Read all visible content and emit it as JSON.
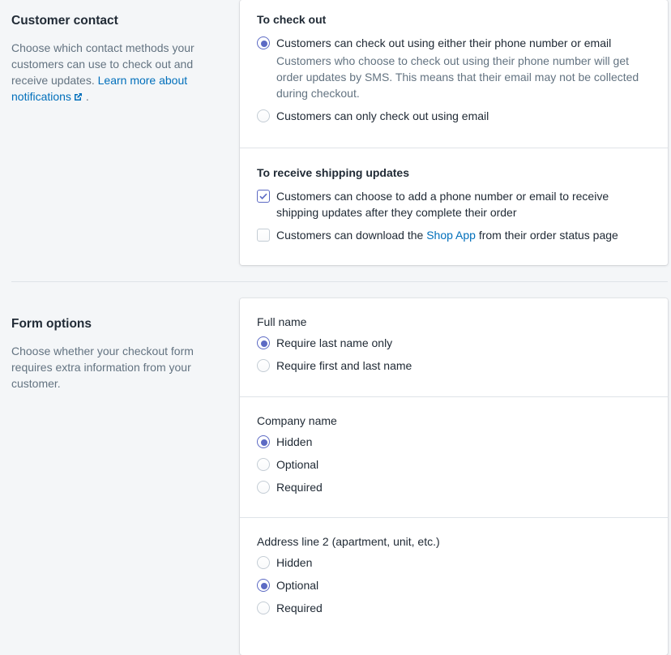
{
  "customer_contact": {
    "title": "Customer contact",
    "description": "Choose which contact methods your customers can use to check out and receive updates.",
    "learn_more_link": "Learn more about notifications",
    "trailing_period": ".",
    "external_icon": "external-link-icon",
    "checkout": {
      "heading": "To check out",
      "options": [
        {
          "label": "Customers can check out using either their phone number or email",
          "help": "Customers who choose to check out using their phone number will get order updates by SMS. This means that their email may not be collected during checkout.",
          "selected": true
        },
        {
          "label": "Customers can only check out using email",
          "selected": false
        }
      ]
    },
    "shipping_updates": {
      "heading": "To receive shipping updates",
      "option_1_label": "Customers can choose to add a phone number or email to receive shipping updates after they complete their order",
      "option_1_checked": true,
      "option_2_prefix": "Customers can download the",
      "option_2_link": "Shop App",
      "option_2_suffix": "from their order status page",
      "option_2_checked": false
    }
  },
  "form_options": {
    "title": "Form options",
    "description": "Choose whether your checkout form requires extra information from your customer.",
    "full_name": {
      "heading": "Full name",
      "options": [
        {
          "label": "Require last name only",
          "selected": true
        },
        {
          "label": "Require first and last name",
          "selected": false
        }
      ]
    },
    "company_name": {
      "heading": "Company name",
      "options": [
        {
          "label": "Hidden",
          "selected": true
        },
        {
          "label": "Optional",
          "selected": false
        },
        {
          "label": "Required",
          "selected": false
        }
      ]
    },
    "address_line_2": {
      "heading": "Address line 2 (apartment, unit, etc.)",
      "options": [
        {
          "label": "Hidden",
          "selected": false
        },
        {
          "label": "Optional",
          "selected": true
        },
        {
          "label": "Required",
          "selected": false
        }
      ]
    }
  },
  "colors": {
    "accent": "#5c6ac4",
    "link": "#006fbb",
    "background": "#f4f6f8",
    "muted_text": "#637381"
  }
}
